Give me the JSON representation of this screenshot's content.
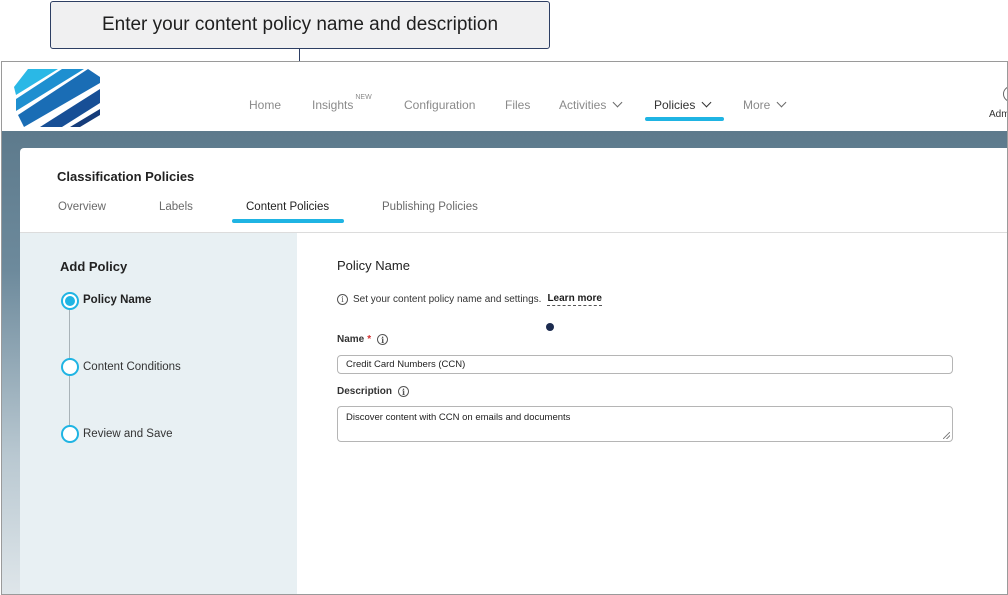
{
  "callout": {
    "text": "Enter your content policy name and description"
  },
  "nav": {
    "items": [
      {
        "label": "Home"
      },
      {
        "label": "Insights",
        "badge": "NEW"
      },
      {
        "label": "Configuration"
      },
      {
        "label": "Files"
      },
      {
        "label": "Activities"
      },
      {
        "label": "Policies",
        "active": true
      },
      {
        "label": "More"
      }
    ],
    "user": "Adm",
    "accent_color": "#1fb4e3"
  },
  "page": {
    "title": "Classification Policies",
    "tabs": [
      {
        "label": "Overview"
      },
      {
        "label": "Labels"
      },
      {
        "label": "Content Policies",
        "active": true
      },
      {
        "label": "Publishing Policies"
      }
    ]
  },
  "steps": {
    "title": "Add Policy",
    "items": [
      {
        "label": "Policy Name",
        "current": true
      },
      {
        "label": "Content Conditions"
      },
      {
        "label": "Review and Save"
      }
    ]
  },
  "form": {
    "title": "Policy Name",
    "info_text": "Set your content policy name and settings.",
    "learn_more": "Learn more",
    "name_label": "Name",
    "name_required": "*",
    "name_value": "Credit Card Numbers (CCN)",
    "description_label": "Description",
    "description_value": "Discover content with CCN on emails and documents"
  }
}
